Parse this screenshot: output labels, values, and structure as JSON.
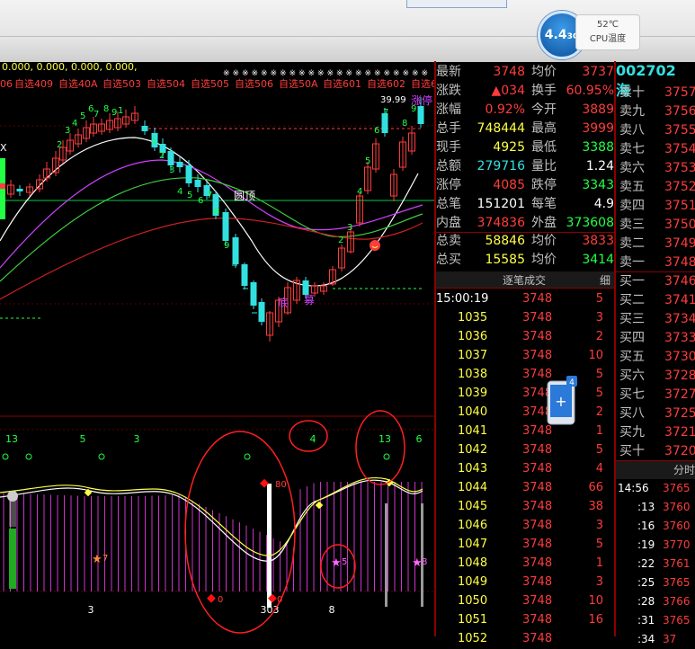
{
  "speed": {
    "value": "4.4",
    "unit": "3G"
  },
  "temp": {
    "value": "52℃",
    "label": "CPU温度"
  },
  "indicator_line": {
    "values": "0.000,  0.000,  0.000,  0.000,"
  },
  "watch_labels": [
    "06",
    "自选409",
    "自选40A",
    "自选503",
    "自选504",
    "自选505",
    "自选506",
    "自选50A",
    "自选601",
    "自选602",
    "自选60"
  ],
  "chart_annotations": {
    "price_high": "39.99",
    "x_label": "X",
    "yuanding": "圆顶",
    "di": "底",
    "mu": "募",
    "zhangting": "涨停",
    "up_counts": [
      "2",
      "3",
      "4",
      "5",
      "6",
      "7",
      "8",
      "9",
      "1",
      "2",
      "3",
      "4",
      "5",
      "6",
      "7",
      "8",
      "9"
    ],
    "down_counts": [
      "1",
      "2",
      "3",
      "4",
      "5",
      "6",
      "7",
      "8",
      "9"
    ],
    "lower_top_counts": [
      "13",
      "5",
      "3",
      "4",
      "13",
      "6"
    ],
    "lower_markers": [
      "7",
      "0",
      "80",
      "5",
      "8",
      "0"
    ],
    "bottom_labels": [
      "3",
      "303",
      "8"
    ]
  },
  "quote": {
    "rows": [
      {
        "l1": "最新",
        "v1": "3748",
        "l2": "均价",
        "v2": "3737"
      },
      {
        "l1": "涨跌",
        "v1": "▲034",
        "l2": "换手",
        "v2": "60.95%"
      },
      {
        "l1": "涨幅",
        "v1": "0.92%",
        "l2": "今开",
        "v2": "3889"
      },
      {
        "l1": "总手",
        "v1": "748444",
        "l2": "最高",
        "v2": "3999"
      },
      {
        "l1": "现手",
        "v1": "4925",
        "l2": "最低",
        "v2": "3388"
      },
      {
        "l1": "总额",
        "v1": "279716",
        "l2": "量比",
        "v2": "1.24"
      },
      {
        "l1": "涨停",
        "v1": "4085",
        "l2": "跌停",
        "v2": "3343"
      },
      {
        "l1": "总笔",
        "v1": "151201",
        "l2": "每笔",
        "v2": "4.9"
      },
      {
        "l1": "内盘",
        "v1": "374836",
        "l2": "外盘",
        "v2": "373608"
      }
    ],
    "sell_total": {
      "l1": "总卖",
      "v1": "58846",
      "l2": "均价",
      "v2": "3833"
    },
    "buy_total": {
      "l1": "总买",
      "v1": "15585",
      "l2": "均价",
      "v2": "3414"
    },
    "ticks_title": "逐笔成交",
    "ticks_detail": "细",
    "first_time": "15:00:19",
    "ticks": [
      {
        "t": "15:00:19",
        "p": "3748",
        "v": "5"
      },
      {
        "t": "1035",
        "p": "3748",
        "v": "3"
      },
      {
        "t": "1036",
        "p": "3748",
        "v": "2"
      },
      {
        "t": "1037",
        "p": "3748",
        "v": "10"
      },
      {
        "t": "1038",
        "p": "3748",
        "v": "5"
      },
      {
        "t": "1039",
        "p": "3748",
        "v": "5"
      },
      {
        "t": "1040",
        "p": "3748",
        "v": "2"
      },
      {
        "t": "1041",
        "p": "3748",
        "v": "1"
      },
      {
        "t": "1042",
        "p": "3748",
        "v": "5"
      },
      {
        "t": "1043",
        "p": "3748",
        "v": "4"
      },
      {
        "t": "1044",
        "p": "3748",
        "v": "66"
      },
      {
        "t": "1045",
        "p": "3748",
        "v": "38"
      },
      {
        "t": "1046",
        "p": "3748",
        "v": "3"
      },
      {
        "t": "1047",
        "p": "3748",
        "v": "5"
      },
      {
        "t": "1048",
        "p": "3748",
        "v": "1"
      },
      {
        "t": "1049",
        "p": "3748",
        "v": "3"
      },
      {
        "t": "1050",
        "p": "3748",
        "v": "10"
      },
      {
        "t": "1051",
        "p": "3748",
        "v": "16"
      },
      {
        "t": "1052",
        "p": "3748",
        "v": ""
      }
    ],
    "badge": "4"
  },
  "book": {
    "code": "002702",
    "name": "海",
    "sells": [
      {
        "l": "卖十",
        "p": "3757"
      },
      {
        "l": "卖九",
        "p": "3756"
      },
      {
        "l": "卖八",
        "p": "3755"
      },
      {
        "l": "卖七",
        "p": "3754"
      },
      {
        "l": "卖六",
        "p": "3753"
      },
      {
        "l": "卖五",
        "p": "3752"
      },
      {
        "l": "卖四",
        "p": "3751"
      },
      {
        "l": "卖三",
        "p": "3750"
      },
      {
        "l": "卖二",
        "p": "3749"
      },
      {
        "l": "卖一",
        "p": "3748"
      }
    ],
    "buys": [
      {
        "l": "买一",
        "p": "3746"
      },
      {
        "l": "买二",
        "p": "3741"
      },
      {
        "l": "买三",
        "p": "3734"
      },
      {
        "l": "买四",
        "p": "3733"
      },
      {
        "l": "买五",
        "p": "3730"
      },
      {
        "l": "买六",
        "p": "3728"
      },
      {
        "l": "买七",
        "p": "3727"
      },
      {
        "l": "买八",
        "p": "3725"
      },
      {
        "l": "买九",
        "p": "3721"
      },
      {
        "l": "买十",
        "p": "3720"
      }
    ],
    "minute_title": "分时",
    "minute_rows": [
      {
        "t": "14:56",
        "p": "3765"
      },
      {
        "t": ":13",
        "p": "3760"
      },
      {
        "t": ":16",
        "p": "3760"
      },
      {
        "t": ":19",
        "p": "3770"
      },
      {
        "t": ":22",
        "p": "3761"
      },
      {
        "t": ":25",
        "p": "3765"
      },
      {
        "t": ":28",
        "p": "3766"
      },
      {
        "t": ":31",
        "p": "3765"
      },
      {
        "t": ":34",
        "p": "37"
      }
    ]
  },
  "colors": {
    "up": "#ff3c3c",
    "down": "#22ff44",
    "flat": "#ffffff",
    "accent": "#33e0e0"
  }
}
